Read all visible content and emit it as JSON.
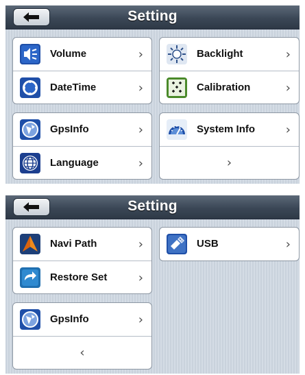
{
  "screens": [
    {
      "title": "Setting",
      "groups": [
        {
          "rows": [
            {
              "label": "Volume",
              "icon": "volume-icon",
              "chevron": "›"
            },
            {
              "label": "DateTime",
              "icon": "datetime-icon",
              "chevron": "›"
            }
          ]
        },
        {
          "rows": [
            {
              "label": "Backlight",
              "icon": "backlight-icon",
              "chevron": "›"
            },
            {
              "label": "Calibration",
              "icon": "calibration-icon",
              "chevron": "›"
            }
          ]
        },
        {
          "rows": [
            {
              "label": "GpsInfo",
              "icon": "gpsinfo-icon",
              "chevron": "›"
            },
            {
              "label": "Language",
              "icon": "language-icon",
              "chevron": "›"
            }
          ]
        },
        {
          "rows": [
            {
              "label": "System Info",
              "icon": "system-info-icon",
              "chevron": "›"
            },
            {
              "label": "",
              "icon": "",
              "chevron": "›"
            }
          ]
        }
      ]
    },
    {
      "title": "Setting",
      "groups": [
        {
          "rows": [
            {
              "label": "Navi Path",
              "icon": "navi-path-icon",
              "chevron": "›"
            },
            {
              "label": "Restore Set",
              "icon": "restore-set-icon",
              "chevron": "›"
            }
          ]
        },
        {
          "rows": [
            {
              "label": "USB",
              "icon": "usb-icon",
              "chevron": "›"
            }
          ]
        },
        {
          "rows": [
            {
              "label": "GpsInfo",
              "icon": "gpsinfo-icon",
              "chevron": "›"
            },
            {
              "label": "",
              "icon": "",
              "chevron": "‹"
            }
          ]
        }
      ]
    }
  ],
  "colors": {
    "titlebar": "#3b4756",
    "background": "#ccd5df",
    "text": "#111111"
  }
}
